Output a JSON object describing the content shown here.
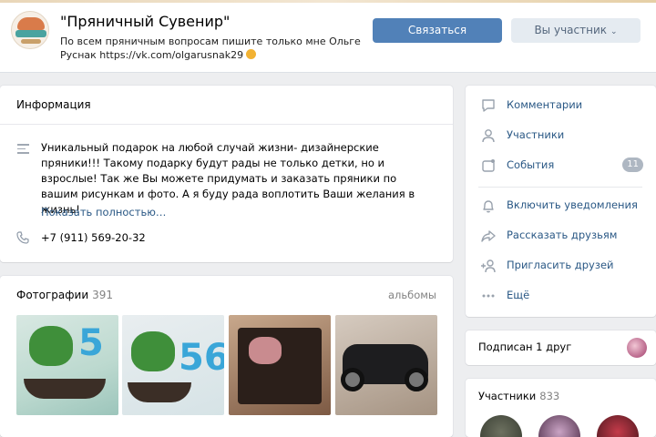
{
  "header": {
    "title": "\"Пряничный Сувенир\"",
    "status": "По всем пряничным вопросам пишите только мне Ольге Руснак https://vk.com/olgarusnak29",
    "contact_button": "Связаться",
    "member_button": "Вы участник"
  },
  "info": {
    "title": "Информация",
    "description": "Уникальный подарок на любой случай жизни- дизайнерские пряники!!! Такому подарку будут рады не только детки, но и взрослые! Так же Вы можете придумать и заказать пряники по вашим рисункам и фото. А я буду рада воплотить Ваши желания в жизнь!",
    "show_more": "Показать полностью…",
    "phone": "+7 (911) 569-20-32"
  },
  "photos": {
    "title": "Фотографии",
    "count": "391",
    "albums_link": "альбомы"
  },
  "menu": {
    "items": [
      {
        "label": "Комментарии",
        "icon": "comment-icon"
      },
      {
        "label": "Участники",
        "icon": "user-icon"
      },
      {
        "label": "События",
        "icon": "calendar-icon",
        "badge": "11"
      },
      {
        "label": "Включить уведомления",
        "icon": "bell-icon"
      },
      {
        "label": "Рассказать друзьям",
        "icon": "share-icon"
      },
      {
        "label": "Пригласить друзей",
        "icon": "add-user-icon"
      },
      {
        "label": "Ещё",
        "icon": "more-icon"
      }
    ]
  },
  "friends": {
    "label": "Подписан 1 друг"
  },
  "members": {
    "title": "Участники",
    "count": "833"
  },
  "colors": {
    "accent": "#5181b8",
    "link": "#2a5885",
    "background": "#edeef0"
  }
}
